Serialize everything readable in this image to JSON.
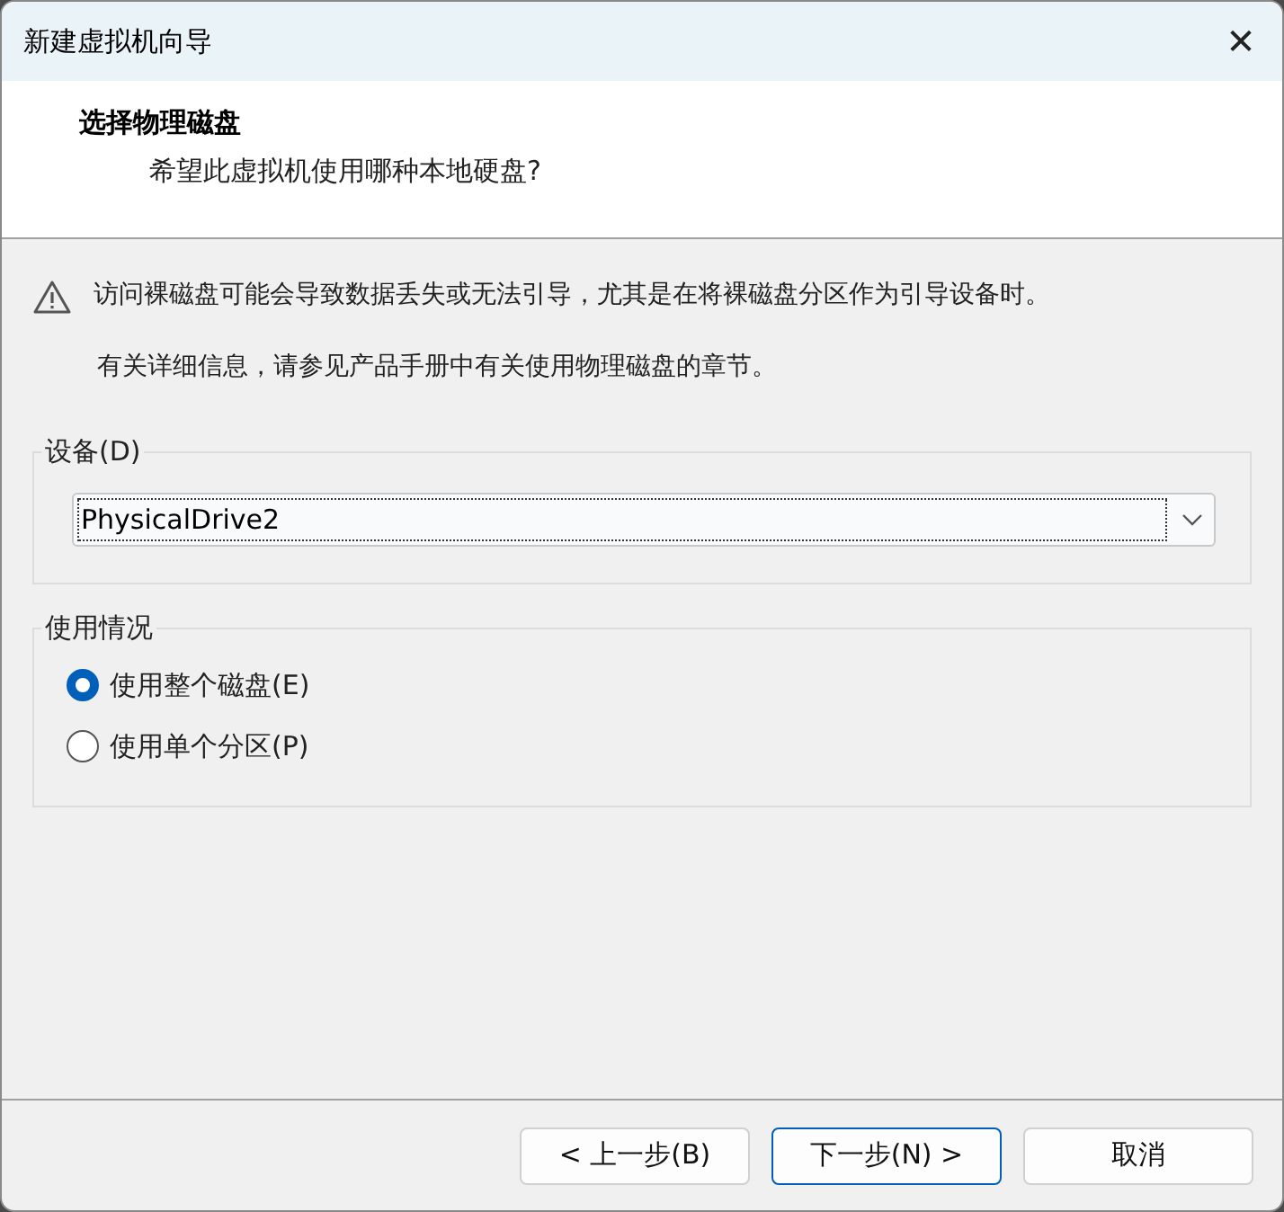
{
  "window": {
    "title": "新建虚拟机向导",
    "close": "✕"
  },
  "header": {
    "title": "选择物理磁盘",
    "subtitle": "希望此虚拟机使用哪种本地硬盘?"
  },
  "warning": {
    "text": "访问裸磁盘可能会导致数据丢失或无法引导，尤其是在将裸磁盘分区作为引导设备时。",
    "info": "有关详细信息，请参见产品手册中有关使用物理磁盘的章节。"
  },
  "device_group": {
    "label": "设备(D)",
    "value": "PhysicalDrive2"
  },
  "usage_group": {
    "label": "使用情况",
    "options": [
      {
        "label": "使用整个磁盘(E)",
        "selected": true
      },
      {
        "label": "使用单个分区(P)",
        "selected": false
      }
    ]
  },
  "buttons": [
    {
      "label": "< 上一步(B)",
      "default": false
    },
    {
      "label": "下一步(N) >",
      "default": true
    },
    {
      "label": "取消",
      "default": false
    }
  ]
}
